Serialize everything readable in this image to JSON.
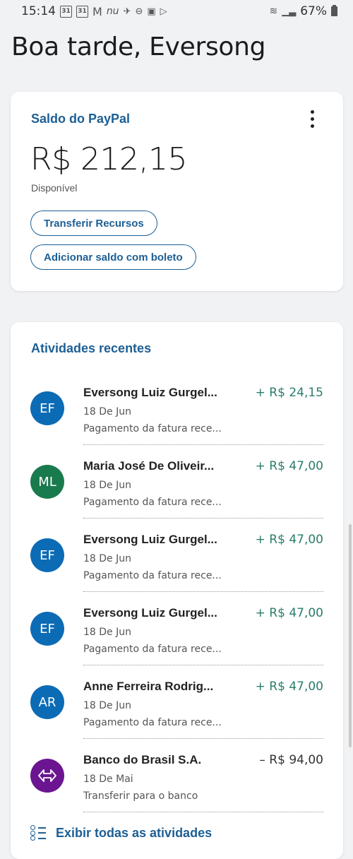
{
  "status_bar": {
    "time": "15:14",
    "battery": "67%",
    "cal1": "31",
    "cal2": "31",
    "nu": "nu"
  },
  "greeting": "Boa tarde, Eversong",
  "balance": {
    "title": "Saldo do PayPal",
    "amount": "R$ 212,15",
    "caption": "Disponível",
    "transfer_label": "Transferir Recursos",
    "boleto_label": "Adicionar saldo com boleto"
  },
  "activity": {
    "title": "Atividades recentes",
    "items": [
      {
        "initials": "EF",
        "avatar_color": "#0c6bb5",
        "name": "Eversong Luiz Gurgel...",
        "date": "18 De Jun",
        "desc": "Pagamento da fatura rece...",
        "amount": "+ R$ 24,15",
        "type": "credit"
      },
      {
        "initials": "ML",
        "avatar_color": "#197a4e",
        "name": "Maria José De Oliveir...",
        "date": "18 De Jun",
        "desc": "Pagamento da fatura rece...",
        "amount": "+ R$ 47,00",
        "type": "credit"
      },
      {
        "initials": "EF",
        "avatar_color": "#0c6bb5",
        "name": "Eversong Luiz Gurgel...",
        "date": "18 De Jun",
        "desc": "Pagamento da fatura rece...",
        "amount": "+ R$ 47,00",
        "type": "credit"
      },
      {
        "initials": "EF",
        "avatar_color": "#0c6bb5",
        "name": "Eversong Luiz Gurgel...",
        "date": "18 De Jun",
        "desc": "Pagamento da fatura rece...",
        "amount": "+ R$ 47,00",
        "type": "credit"
      },
      {
        "initials": "AR",
        "avatar_color": "#0c6bb5",
        "name": "Anne Ferreira Rodrig...",
        "date": "18 De Jun",
        "desc": "Pagamento da fatura rece...",
        "amount": "+ R$ 47,00",
        "type": "credit"
      },
      {
        "initials": "",
        "avatar_icon": "transfer-arrows-icon",
        "avatar_color": "#6b1591",
        "name": "Banco do Brasil S.A.",
        "date": "18 De Mai",
        "desc": "Transferir para o banco",
        "amount": "– R$ 94,00",
        "type": "debit"
      }
    ],
    "show_all_label": "Exibir todas as atividades"
  },
  "colors": {
    "brand_blue": "#1d5f94",
    "credit_green": "#2a7d6c",
    "background": "#f1f2f4"
  }
}
